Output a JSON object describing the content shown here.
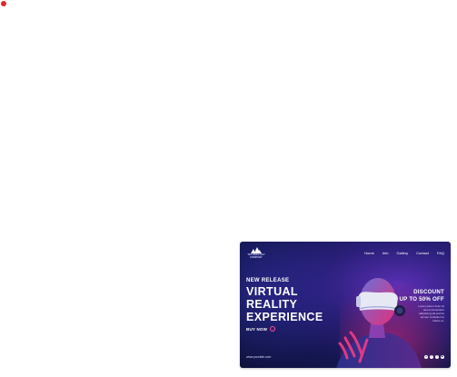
{
  "banner": {
    "logo": {
      "line1": "TECHNOLOGY",
      "line2": "COMPANY"
    },
    "nav": [
      "Home",
      "Info",
      "Gallery",
      "Contact",
      "FAQ"
    ],
    "new_release": "NEW RELEASE",
    "headline": [
      "VIRTUAL",
      "REALITY",
      "EXPERIENCE"
    ],
    "buy_now": "BUY NOW",
    "buy_now_icon": "arrow-right-icon",
    "website": "www.yoursite.com",
    "discount": [
      "DISCOUNT",
      "UP TO 50% OFF"
    ],
    "discount_body": [
      "Lorem ipsum dolor sit",
      "amet,consectetur",
      "adipiscing elit,sed do",
      "tempor incididunt ut",
      "labore et."
    ],
    "social_icons": [
      "instagram-icon",
      "facebook-icon",
      "twitter-icon",
      "youtube-icon"
    ],
    "colors": {
      "accent": "#ff4f8e",
      "background_dark": "#141650",
      "background_mid": "#2a1f7a"
    }
  },
  "recording_indicator_color": "#e0282e"
}
